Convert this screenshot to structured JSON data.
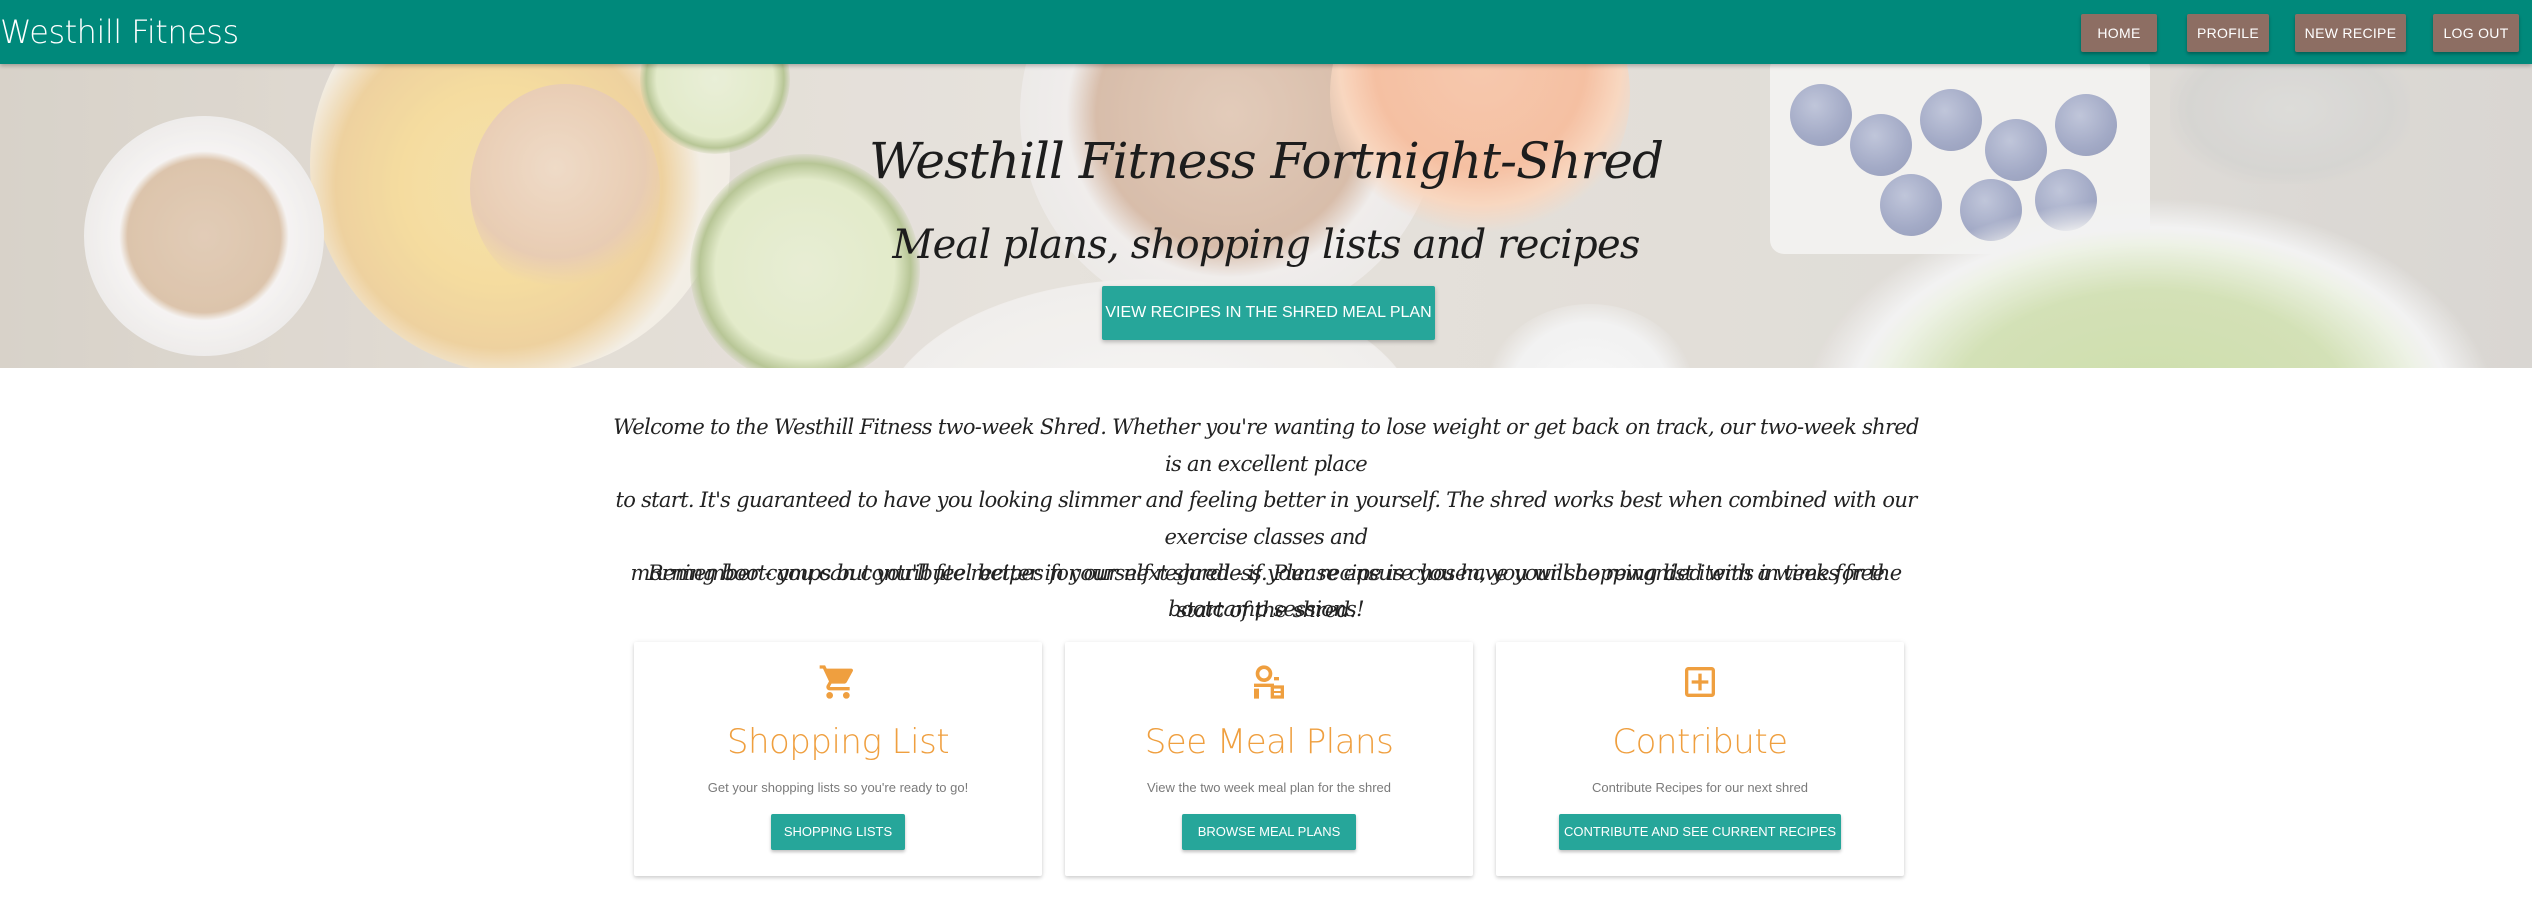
{
  "nav": {
    "brand": "Westhill Fitness",
    "links": [
      "HOME",
      "PROFILE",
      "NEW RECIPE",
      "LOG OUT"
    ]
  },
  "hero": {
    "title": "Westhill Fitness Fortnight-Shred",
    "subtitle": "Meal plans, shopping lists and recipes",
    "button": "VIEW RECIPES IN THE SHRED MEAL PLAN"
  },
  "intro": {
    "lines": [
      "Welcome to the Westhill Fitness two-week Shred. Whether you're wanting to lose weight or get back on track, our two-week shred is an excellent place",
      "to start. It's guaranteed to have you looking slimmer and feeling better in yourself. The shred works best when combined with our exercise classes and",
      "morning bootcamps but you'll feel better in yourself regardless. Please ensure you have your shopping list items in time for the start of the shred."
    ],
    "remember": "Remember - you can contribute recipes for our next shred - if your recipe is chosen, you will be rewarded with a weeks free bootcamp sessions!"
  },
  "cards": [
    {
      "icon": "shopping-cart-icon",
      "title": "Shopping List",
      "description": "Get your shopping lists so you're ready to go!",
      "button": "SHOPPING LISTS"
    },
    {
      "icon": "meal-plan-icon",
      "title": "See Meal Plans",
      "description": "View the two week meal plan for the shred",
      "button": "BROWSE MEAL PLANS"
    },
    {
      "icon": "add-box-icon",
      "title": "Contribute",
      "description": "Contribute Recipes for our next shred",
      "button": "CONTRIBUTE AND SEE CURRENT RECIPES"
    }
  ],
  "colors": {
    "navbar": "#00897b",
    "nav_button": "#8d6e63",
    "primary_button": "#26a69a",
    "card_accent": "#ef9f3f"
  }
}
